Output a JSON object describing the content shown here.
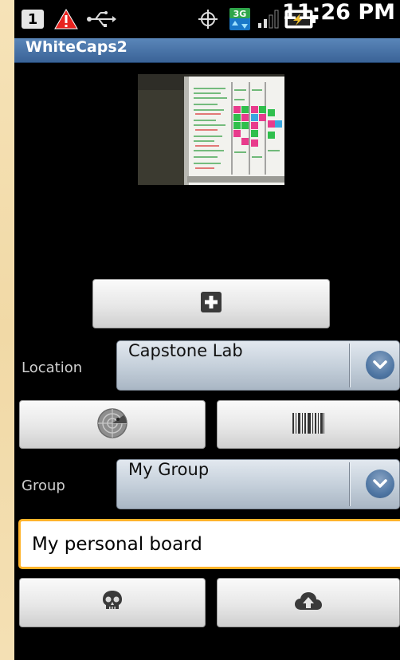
{
  "status_bar": {
    "sim_label": "1",
    "time": "11:26 PM",
    "icons": [
      "sim-icon",
      "warning-icon",
      "usb-icon",
      "gps-icon",
      "3g-data-icon",
      "signal-icon",
      "battery-charging-icon"
    ]
  },
  "app": {
    "title": "WhiteCaps2"
  },
  "form": {
    "location_label": "Location",
    "location_value": "Capstone Lab",
    "group_label": "Group",
    "group_value": "My Group",
    "board_name_value": "My personal board"
  },
  "buttons": {
    "add": "plus-icon",
    "locate": "radar-icon",
    "barcode": "barcode-icon",
    "delete": "skull-icon",
    "upload": "cloud-upload-icon"
  },
  "colors": {
    "title_bar": "#3a6397",
    "input_focus": "#ffb32a",
    "spinner_arrow": "#5077a4"
  }
}
